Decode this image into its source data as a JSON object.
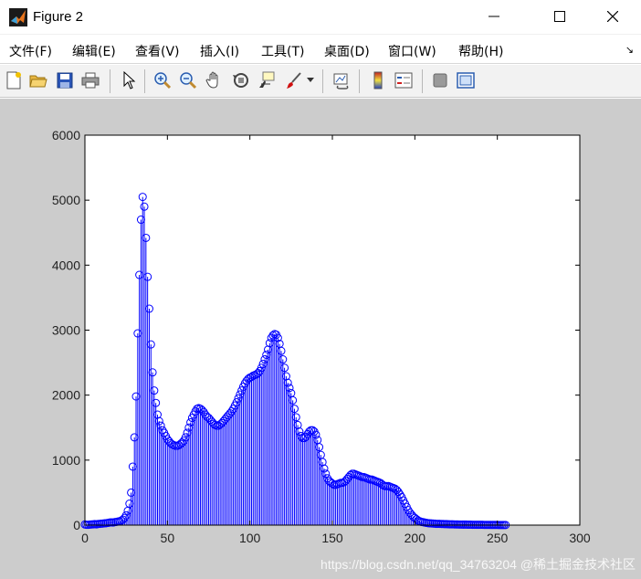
{
  "window": {
    "title": "Figure 2",
    "minimize_glyph": "—",
    "maximize_glyph": "☐",
    "close_glyph": "✕"
  },
  "menu": {
    "items": [
      "文件(F)",
      "编辑(E)",
      "查看(V)",
      "插入(I)",
      "工具(T)",
      "桌面(D)",
      "窗口(W)",
      "帮助(H)"
    ],
    "overflow_glyph": "↘"
  },
  "toolbar": {
    "buttons": [
      "new-figure-icon",
      "open-file-icon",
      "save-icon",
      "print-icon",
      "pointer-arrow-icon",
      "zoom-in-icon",
      "zoom-out-icon",
      "pan-hand-icon",
      "rotate-3d-icon",
      "data-cursor-icon",
      "brush-icon",
      "brush-dropdown-icon",
      "link-plot-icon",
      "colorbar-icon",
      "legend-icon",
      "hide-plot-tools-icon",
      "show-plot-tools-icon"
    ]
  },
  "colors": {
    "series": "#0000ff",
    "figure_bg": "#cccccc",
    "axes_bg": "#ffffff"
  },
  "chart_data": {
    "type": "stem",
    "marker": "circle",
    "xlim": [
      0,
      300
    ],
    "ylim": [
      0,
      6000
    ],
    "xticks": [
      0,
      50,
      100,
      150,
      200,
      250,
      300
    ],
    "yticks": [
      0,
      1000,
      2000,
      3000,
      4000,
      5000,
      6000
    ],
    "grid": false,
    "x": [
      0,
      1,
      2,
      3,
      4,
      5,
      6,
      7,
      8,
      9,
      10,
      11,
      12,
      13,
      14,
      15,
      16,
      17,
      18,
      19,
      20,
      21,
      22,
      23,
      24,
      25,
      26,
      27,
      28,
      29,
      30,
      31,
      32,
      33,
      34,
      35,
      36,
      37,
      38,
      39,
      40,
      41,
      42,
      43,
      44,
      45,
      46,
      47,
      48,
      49,
      50,
      51,
      52,
      53,
      54,
      55,
      56,
      57,
      58,
      59,
      60,
      61,
      62,
      63,
      64,
      65,
      66,
      67,
      68,
      69,
      70,
      71,
      72,
      73,
      74,
      75,
      76,
      77,
      78,
      79,
      80,
      81,
      82,
      83,
      84,
      85,
      86,
      87,
      88,
      89,
      90,
      91,
      92,
      93,
      94,
      95,
      96,
      97,
      98,
      99,
      100,
      101,
      102,
      103,
      104,
      105,
      106,
      107,
      108,
      109,
      110,
      111,
      112,
      113,
      114,
      115,
      116,
      117,
      118,
      119,
      120,
      121,
      122,
      123,
      124,
      125,
      126,
      127,
      128,
      129,
      130,
      131,
      132,
      133,
      134,
      135,
      136,
      137,
      138,
      139,
      140,
      141,
      142,
      143,
      144,
      145,
      146,
      147,
      148,
      149,
      150,
      151,
      152,
      153,
      154,
      155,
      156,
      157,
      158,
      159,
      160,
      161,
      162,
      163,
      164,
      165,
      166,
      167,
      168,
      169,
      170,
      171,
      172,
      173,
      174,
      175,
      176,
      177,
      178,
      179,
      180,
      181,
      182,
      183,
      184,
      185,
      186,
      187,
      188,
      189,
      190,
      191,
      192,
      193,
      194,
      195,
      196,
      197,
      198,
      199,
      200,
      201,
      202,
      203,
      204,
      205,
      206,
      207,
      208,
      209,
      210,
      211,
      212,
      213,
      214,
      215,
      216,
      217,
      218,
      219,
      220,
      221,
      222,
      223,
      224,
      225,
      226,
      227,
      228,
      229,
      230,
      231,
      232,
      233,
      234,
      235,
      236,
      237,
      238,
      239,
      240,
      241,
      242,
      243,
      244,
      245,
      246,
      247,
      248,
      249,
      250,
      251,
      252,
      253,
      254,
      255
    ],
    "y": [
      10,
      5,
      5,
      8,
      10,
      12,
      15,
      12,
      18,
      20,
      22,
      25,
      28,
      30,
      35,
      40,
      42,
      40,
      45,
      50,
      55,
      60,
      70,
      85,
      110,
      150,
      220,
      330,
      500,
      900,
      1350,
      1980,
      2950,
      3850,
      4700,
      5050,
      4900,
      4420,
      3820,
      3330,
      2780,
      2350,
      2070,
      1880,
      1700,
      1600,
      1530,
      1460,
      1420,
      1370,
      1320,
      1290,
      1260,
      1240,
      1230,
      1220,
      1220,
      1230,
      1250,
      1270,
      1300,
      1350,
      1420,
      1500,
      1580,
      1650,
      1700,
      1750,
      1790,
      1800,
      1790,
      1770,
      1740,
      1700,
      1670,
      1650,
      1620,
      1590,
      1560,
      1540,
      1530,
      1530,
      1550,
      1570,
      1600,
      1630,
      1660,
      1690,
      1720,
      1750,
      1790,
      1840,
      1890,
      1950,
      2010,
      2070,
      2130,
      2180,
      2220,
      2250,
      2270,
      2280,
      2300,
      2310,
      2320,
      2340,
      2370,
      2420,
      2480,
      2550,
      2620,
      2700,
      2800,
      2880,
      2920,
      2940,
      2930,
      2880,
      2790,
      2680,
      2550,
      2420,
      2290,
      2190,
      2110,
      2030,
      1920,
      1790,
      1660,
      1540,
      1440,
      1370,
      1340,
      1340,
      1360,
      1400,
      1440,
      1460,
      1460,
      1440,
      1390,
      1310,
      1200,
      1080,
      970,
      870,
      790,
      720,
      680,
      660,
      640,
      620,
      620,
      630,
      640,
      650,
      650,
      660,
      680,
      710,
      740,
      770,
      790,
      790,
      780,
      770,
      760,
      750,
      740,
      740,
      730,
      720,
      710,
      700,
      700,
      690,
      680,
      670,
      660,
      650,
      630,
      610,
      600,
      600,
      600,
      590,
      580,
      570,
      560,
      540,
      510,
      470,
      430,
      380,
      330,
      280,
      230,
      190,
      160,
      130,
      110,
      90,
      70,
      60,
      50,
      45,
      40,
      35,
      30,
      28,
      26,
      24,
      22,
      20,
      20,
      19,
      18,
      17,
      16,
      15,
      14,
      13,
      12,
      12,
      11,
      10,
      10,
      9,
      9,
      8,
      8,
      8,
      7,
      7,
      7,
      6,
      6,
      6,
      5,
      5,
      5,
      5,
      4,
      4,
      4,
      4,
      3,
      3,
      3,
      3,
      3,
      2,
      2,
      2,
      2,
      2,
      2,
      2,
      2,
      1,
      1,
      1
    ]
  },
  "watermark": "https://blog.csdn.net/qq_34763204  @稀土掘金技术社区"
}
